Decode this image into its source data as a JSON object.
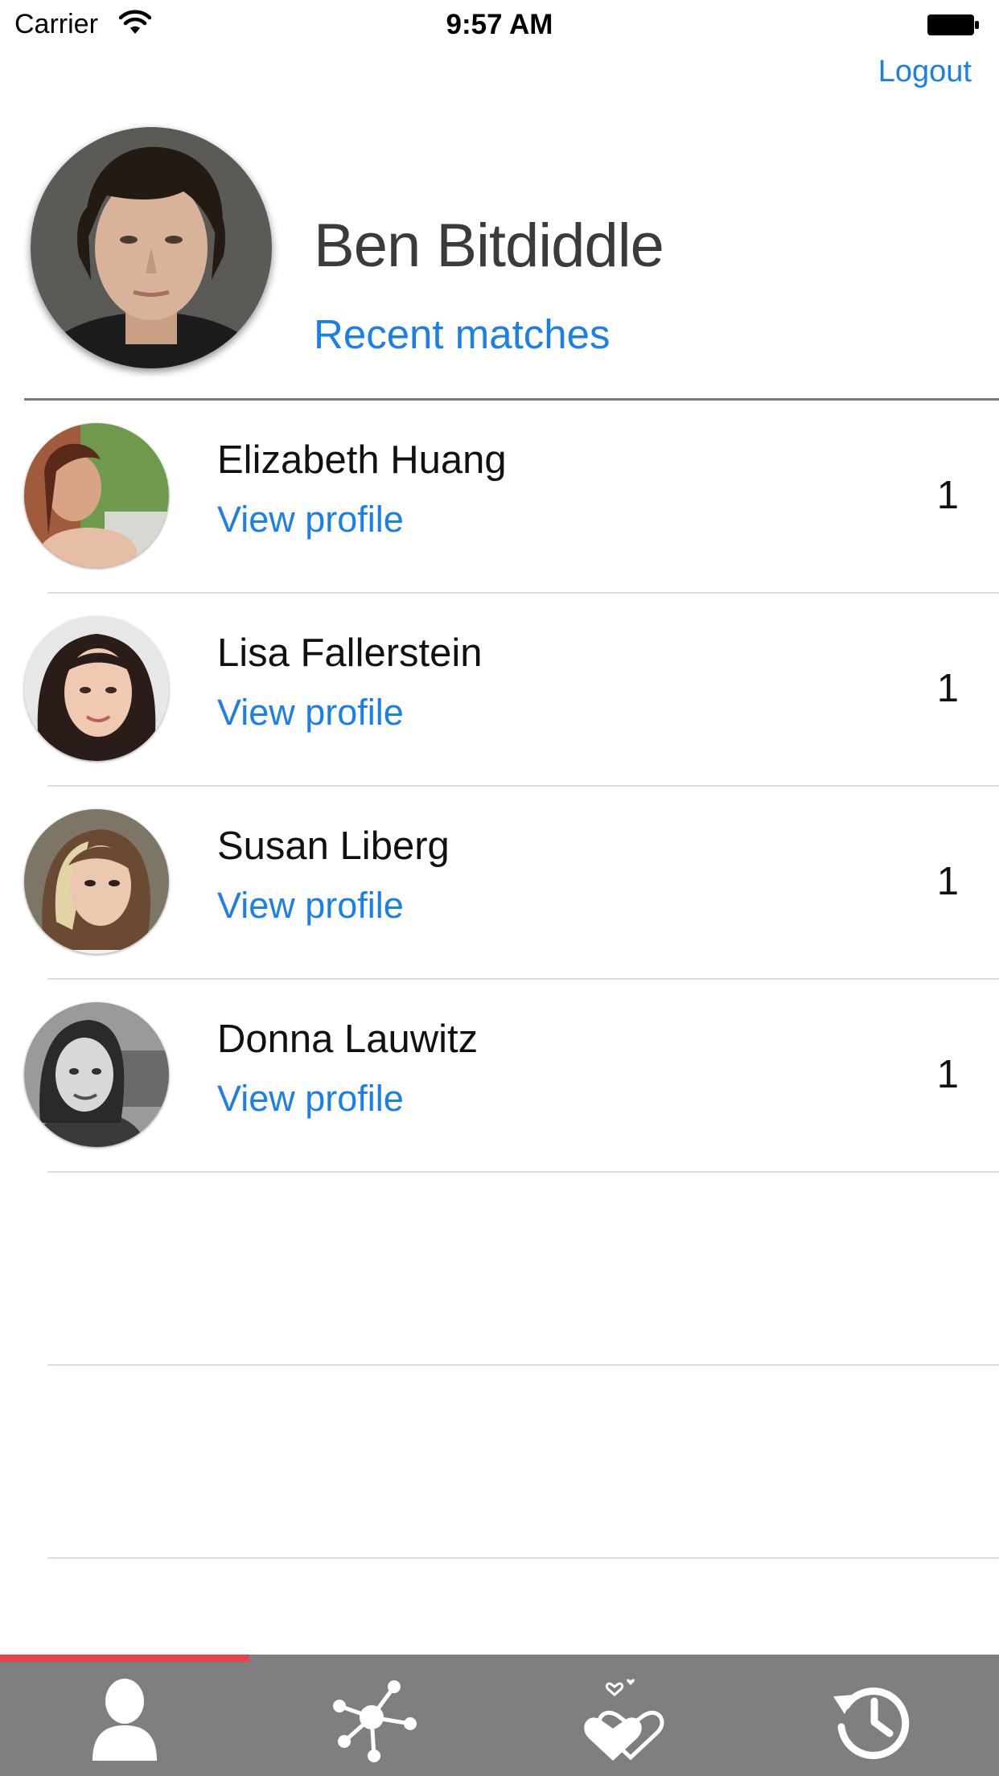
{
  "status_bar": {
    "carrier": "Carrier",
    "time": "9:57 AM"
  },
  "header": {
    "logout_label": "Logout",
    "user_name": "Ben Bitdiddle",
    "recent_matches_label": "Recent matches"
  },
  "matches": [
    {
      "name": "Elizabeth Huang",
      "link_label": "View profile",
      "count": "1"
    },
    {
      "name": "Lisa Fallerstein",
      "link_label": "View profile",
      "count": "1"
    },
    {
      "name": "Susan Liberg",
      "link_label": "View profile",
      "count": "1"
    },
    {
      "name": "Donna Lauwitz",
      "link_label": "View profile",
      "count": "1"
    }
  ],
  "tab_bar": {
    "tabs": [
      {
        "icon": "person-icon",
        "selected": true
      },
      {
        "icon": "network-icon",
        "selected": false
      },
      {
        "icon": "hearts-icon",
        "selected": false
      },
      {
        "icon": "history-icon",
        "selected": false
      }
    ]
  },
  "colors": {
    "link": "#1a7fe8",
    "tab_bar_bg": "#7f7f7f",
    "tab_indicator": "#e8434b",
    "divider": "#7a7a7a"
  }
}
